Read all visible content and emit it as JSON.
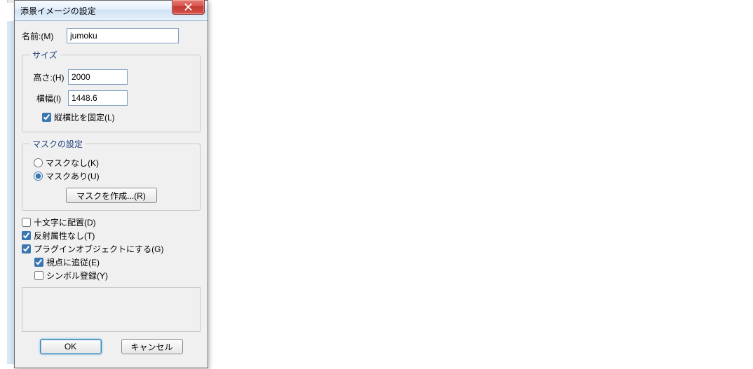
{
  "window": {
    "title": "添景イメージの設定"
  },
  "name": {
    "label": "名前:(M)",
    "value": "jumoku"
  },
  "size": {
    "legend": "サイズ",
    "height_label": "高さ:(H)",
    "height_value": "2000",
    "width_label": "横幅(I)",
    "width_value": "1448.6",
    "lock_aspect_label": "縦横比を固定(L)",
    "lock_aspect_checked": true
  },
  "mask": {
    "legend": "マスクの設定",
    "none_label": "マスクなし(K)",
    "has_label": "マスクあり(U)",
    "selected": "has",
    "create_button": "マスクを作成...(R)"
  },
  "options": {
    "cross_label": "十文字に配置(D)",
    "cross_checked": false,
    "no_reflect_label": "反射属性なし(T)",
    "no_reflect_checked": true,
    "plugin_label": "プラグインオブジェクトにする(G)",
    "plugin_checked": true,
    "follow_view_label": "視点に追従(E)",
    "follow_view_checked": true,
    "symbol_reg_label": "シンボル登録(Y)",
    "symbol_reg_checked": false
  },
  "buttons": {
    "ok": "OK",
    "cancel": "キャンセル"
  }
}
